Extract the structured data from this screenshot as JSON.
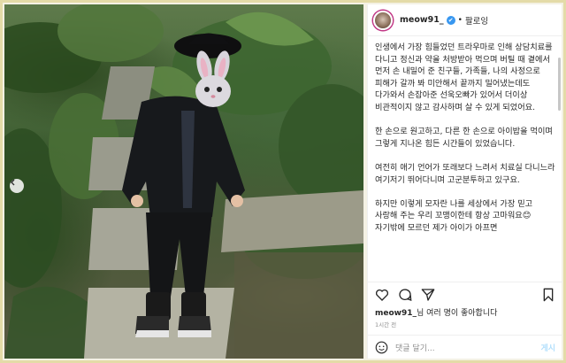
{
  "post": {
    "username": "meow91_",
    "dot": "•",
    "follow_label": "팔로잉",
    "verified_icon": "✔",
    "caption": [
      "인생에서 가장 힘들었던 트라우마로 인해 상담치료를 다니고 정신과 약을 처방받아 먹으며 버틸 때 곁에서 먼저 손 내밀어 준 친구들, 가족들, 나의 사정으로 피해가 갈까 봐 미안해서 끝까지 밀어냈는데도 다가와서 손잡아준 선욱오빠가 있어서 더이상 비관적이지 않고 감사하며 살 수 있게 되었어요.",
      "한 손으로 원고하고, 다른 한 손으로 아이밥을 먹이며 그렇게 지나온 힘든 시간들이 있었습니다.",
      "여전히 애기 언어가 또래보다 느려서 치료실 다니느라 여기저기 뛰어다니며 고군분투하고 있구요.",
      "하지만 이렇게 모자란 나를 세상에서 가장 믿고 사랑해 주는 우리 꼬맹이한테 항상 고마워요😊",
      "자기밖에 모르던 제가 아이가 아프면"
    ],
    "likes_user": "meow91_",
    "likes_suffix": "님 여러 명이 좋아합니다",
    "time": "1시간 전",
    "comment_placeholder": "댓글 달기...",
    "post_button": "게시"
  },
  "colors": {
    "accent_blue": "#3897f0",
    "post_button": "#b2dffc",
    "frame": "#e4dba8"
  },
  "icons": [
    "heart-icon",
    "comment-icon",
    "share-icon",
    "bookmark-icon",
    "emoji-icon",
    "chevron-left-icon",
    "bunny-mask-sticker"
  ]
}
